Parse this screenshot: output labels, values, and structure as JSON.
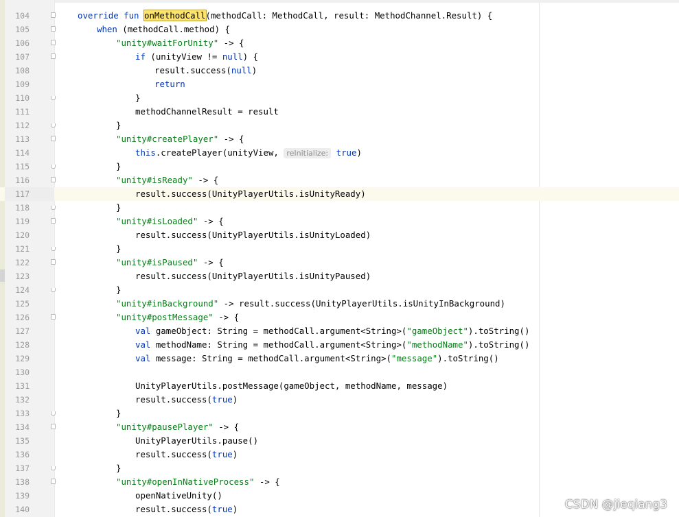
{
  "editor": {
    "lines": [
      {
        "no": "104",
        "fold": "open",
        "indent": 1,
        "seg": [
          {
            "t": "override fun ",
            "c": "kw"
          },
          {
            "t": "onMethodCall",
            "c": "hl"
          },
          {
            "t": "(methodCall: MethodCall, result: MethodChannel.Result) {"
          }
        ]
      },
      {
        "no": "105",
        "fold": "open",
        "indent": 2,
        "seg": [
          {
            "t": "when",
            "c": "kw"
          },
          {
            "t": " (methodCall.method) {"
          }
        ]
      },
      {
        "no": "106",
        "fold": "open",
        "indent": 3,
        "seg": [
          {
            "t": "\"unity#waitForUnity\"",
            "c": "str"
          },
          {
            "t": " -> {"
          }
        ]
      },
      {
        "no": "107",
        "fold": "open",
        "indent": 4,
        "seg": [
          {
            "t": "if",
            "c": "kw"
          },
          {
            "t": " (unityView != "
          },
          {
            "t": "null",
            "c": "kw"
          },
          {
            "t": ") {"
          }
        ]
      },
      {
        "no": "108",
        "fold": "",
        "indent": 5,
        "seg": [
          {
            "t": "result.success("
          },
          {
            "t": "null",
            "c": "kw"
          },
          {
            "t": ")"
          }
        ]
      },
      {
        "no": "109",
        "fold": "",
        "indent": 5,
        "seg": [
          {
            "t": "return",
            "c": "kw"
          }
        ]
      },
      {
        "no": "110",
        "fold": "end",
        "indent": 4,
        "seg": [
          {
            "t": "}"
          }
        ]
      },
      {
        "no": "111",
        "fold": "",
        "indent": 4,
        "seg": [
          {
            "t": "methodChannelResult = result"
          }
        ]
      },
      {
        "no": "112",
        "fold": "end",
        "indent": 3,
        "seg": [
          {
            "t": "}"
          }
        ]
      },
      {
        "no": "113",
        "fold": "open",
        "indent": 3,
        "seg": [
          {
            "t": "\"unity#createPlayer\"",
            "c": "str"
          },
          {
            "t": " -> {"
          }
        ]
      },
      {
        "no": "114",
        "fold": "",
        "indent": 4,
        "seg": [
          {
            "t": "this",
            "c": "kw"
          },
          {
            "t": ".createPlayer(unityView, "
          },
          {
            "t": "reInitialize:",
            "c": "hint"
          },
          {
            "t": " "
          },
          {
            "t": "true",
            "c": "kw"
          },
          {
            "t": ")"
          }
        ]
      },
      {
        "no": "115",
        "fold": "end",
        "indent": 3,
        "seg": [
          {
            "t": "}"
          }
        ]
      },
      {
        "no": "116",
        "fold": "open",
        "indent": 3,
        "seg": [
          {
            "t": "\"unity#isReady\"",
            "c": "str"
          },
          {
            "t": " -> {"
          }
        ]
      },
      {
        "no": "117",
        "fold": "",
        "indent": 4,
        "current": true,
        "seg": [
          {
            "t": "result.success(UnityPlayerUtils.isUnityReady)"
          }
        ]
      },
      {
        "no": "118",
        "fold": "end",
        "indent": 3,
        "seg": [
          {
            "t": "}"
          }
        ]
      },
      {
        "no": "119",
        "fold": "open",
        "indent": 3,
        "seg": [
          {
            "t": "\"unity#isLoaded\"",
            "c": "str"
          },
          {
            "t": " -> {"
          }
        ]
      },
      {
        "no": "120",
        "fold": "",
        "indent": 4,
        "seg": [
          {
            "t": "result.success(UnityPlayerUtils.isUnityLoaded)"
          }
        ]
      },
      {
        "no": "121",
        "fold": "end",
        "indent": 3,
        "seg": [
          {
            "t": "}"
          }
        ]
      },
      {
        "no": "122",
        "fold": "open",
        "indent": 3,
        "seg": [
          {
            "t": "\"unity#isPaused\"",
            "c": "str"
          },
          {
            "t": " -> {"
          }
        ]
      },
      {
        "no": "123",
        "fold": "",
        "indent": 4,
        "seg": [
          {
            "t": "result.success(UnityPlayerUtils.isUnityPaused)"
          }
        ]
      },
      {
        "no": "124",
        "fold": "end",
        "indent": 3,
        "seg": [
          {
            "t": "}"
          }
        ]
      },
      {
        "no": "125",
        "fold": "",
        "indent": 3,
        "seg": [
          {
            "t": "\"unity#inBackground\"",
            "c": "str"
          },
          {
            "t": " -> result.success(UnityPlayerUtils.isUnityInBackground)"
          }
        ]
      },
      {
        "no": "126",
        "fold": "open",
        "indent": 3,
        "seg": [
          {
            "t": "\"unity#postMessage\"",
            "c": "str"
          },
          {
            "t": " -> {"
          }
        ]
      },
      {
        "no": "127",
        "fold": "",
        "indent": 4,
        "seg": [
          {
            "t": "val",
            "c": "kw"
          },
          {
            "t": " gameObject: String = methodCall.argument<String>("
          },
          {
            "t": "\"gameObject\"",
            "c": "str"
          },
          {
            "t": ").toString()"
          }
        ]
      },
      {
        "no": "128",
        "fold": "",
        "indent": 4,
        "seg": [
          {
            "t": "val",
            "c": "kw"
          },
          {
            "t": " methodName: String = methodCall.argument<String>("
          },
          {
            "t": "\"methodName\"",
            "c": "str"
          },
          {
            "t": ").toString()"
          }
        ]
      },
      {
        "no": "129",
        "fold": "",
        "indent": 4,
        "seg": [
          {
            "t": "val",
            "c": "kw"
          },
          {
            "t": " message: String = methodCall.argument<String>("
          },
          {
            "t": "\"message\"",
            "c": "str"
          },
          {
            "t": ").toString()"
          }
        ]
      },
      {
        "no": "130",
        "fold": "",
        "indent": 4,
        "seg": []
      },
      {
        "no": "131",
        "fold": "",
        "indent": 4,
        "seg": [
          {
            "t": "UnityPlayerUtils.postMessage(gameObject, methodName, message)"
          }
        ]
      },
      {
        "no": "132",
        "fold": "",
        "indent": 4,
        "seg": [
          {
            "t": "result.success("
          },
          {
            "t": "true",
            "c": "kw"
          },
          {
            "t": ")"
          }
        ]
      },
      {
        "no": "133",
        "fold": "end",
        "indent": 3,
        "seg": [
          {
            "t": "}"
          }
        ]
      },
      {
        "no": "134",
        "fold": "open",
        "indent": 3,
        "seg": [
          {
            "t": "\"unity#pausePlayer\"",
            "c": "str"
          },
          {
            "t": " -> {"
          }
        ]
      },
      {
        "no": "135",
        "fold": "",
        "indent": 4,
        "seg": [
          {
            "t": "UnityPlayerUtils.pause()"
          }
        ]
      },
      {
        "no": "136",
        "fold": "",
        "indent": 4,
        "seg": [
          {
            "t": "result.success("
          },
          {
            "t": "true",
            "c": "kw"
          },
          {
            "t": ")"
          }
        ]
      },
      {
        "no": "137",
        "fold": "end",
        "indent": 3,
        "seg": [
          {
            "t": "}"
          }
        ]
      },
      {
        "no": "138",
        "fold": "open",
        "indent": 3,
        "seg": [
          {
            "t": "\"unity#openInNativeProcess\"",
            "c": "str"
          },
          {
            "t": " -> {"
          }
        ]
      },
      {
        "no": "139",
        "fold": "",
        "indent": 4,
        "seg": [
          {
            "t": "openNativeUnity()"
          }
        ]
      },
      {
        "no": "140",
        "fold": "",
        "indent": 4,
        "seg": [
          {
            "t": "result.success("
          },
          {
            "t": "true",
            "c": "kw"
          },
          {
            "t": ")"
          }
        ]
      }
    ]
  },
  "watermark": "CSDN @jieqiang3",
  "colors": {
    "keyword": "#0033b3",
    "string": "#067d17",
    "highlight": "#ffe46a",
    "current_line": "#fcfaed"
  }
}
